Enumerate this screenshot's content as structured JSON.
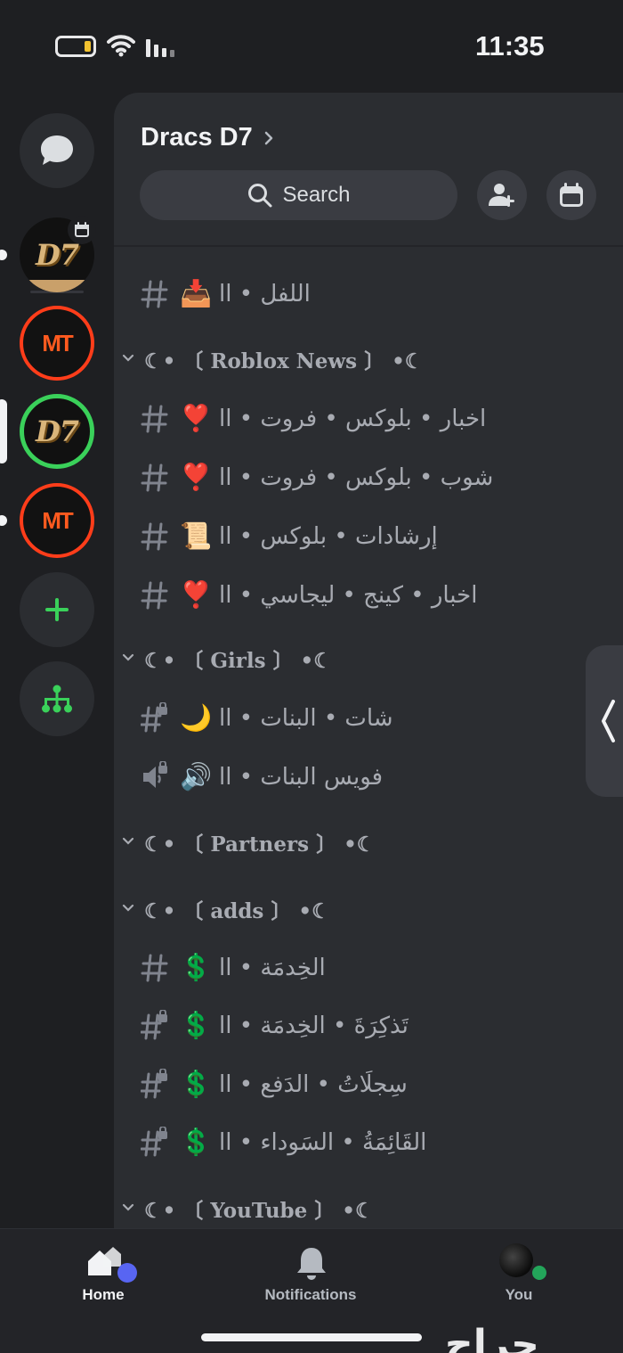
{
  "status_bar": {
    "time": "11:35"
  },
  "server": {
    "name": "Dracs D7"
  },
  "search": {
    "label": "Search"
  },
  "rail": {
    "servers": [
      {
        "logo_text": "D7"
      },
      {
        "logo_text": "MT"
      },
      {
        "logo_text": "D7"
      },
      {
        "logo_text": "MT"
      }
    ]
  },
  "channels": {
    "top": {
      "emoji": "📥",
      "name": "اللفل • اا"
    },
    "categories": [
      {
        "title": "☾• 〔 Roblox News 〕 •☾",
        "channels": [
          {
            "emoji": "❣️",
            "name": "اخبار • بلوكس • فروت • اا"
          },
          {
            "emoji": "❣️",
            "name": "شوب • بلوكس • فروت • اا"
          },
          {
            "emoji": "📜",
            "name": "إرشادات • بلوكس • اا"
          },
          {
            "emoji": "❣️",
            "name": "اخبار • كينج • ليجاسي • اا"
          }
        ]
      },
      {
        "title": "☾• 〔 Girls 〕 •☾",
        "channels": [
          {
            "emoji": "🌙",
            "name": "شات • البنات • اا"
          },
          {
            "emoji": "🔊",
            "name": "فويس البنات • اا"
          }
        ]
      },
      {
        "title": "☾• 〔 Partners 〕 •☾",
        "channels": []
      },
      {
        "title": "☾• 〔 adds 〕 •☾",
        "channels": [
          {
            "emoji": "💲",
            "name": "الخِدمَة • اا"
          },
          {
            "emoji": "💲",
            "name": "تَذكِرَةَ • الخِدمَة • اا"
          },
          {
            "emoji": "💲",
            "name": "سِجلَاتُ • الدَفع • اا"
          },
          {
            "emoji": "💲",
            "name": "القَائِمَةُ • السَوداء • اا"
          }
        ]
      },
      {
        "title": "☾• 〔 YouTube 〕 •☾",
        "channels": []
      }
    ]
  },
  "bottom_nav": {
    "home": "Home",
    "notifications": "Notifications",
    "you": "You"
  },
  "watermark": "حراج",
  "colors": {
    "background": "#1e1f22",
    "panel": "#2b2d31",
    "accent_blurple": "#5865f2",
    "online_green": "#23a55a",
    "add_server_green": "#3ad15a",
    "mt_orange": "#ff3d1a"
  }
}
